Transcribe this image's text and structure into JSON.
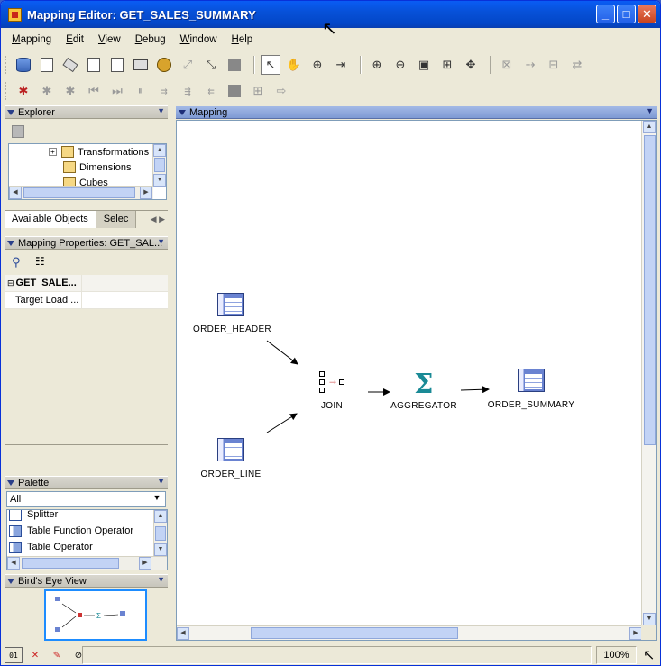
{
  "window": {
    "title": "Mapping Editor: GET_SALES_SUMMARY",
    "minimize": "_",
    "maximize": "□",
    "close": "✕"
  },
  "menu": [
    "Mapping",
    "Edit",
    "View",
    "Debug",
    "Window",
    "Help"
  ],
  "explorer": {
    "title": "Explorer",
    "tree": [
      "Transformations",
      "Dimensions",
      "Cubes"
    ],
    "tabs": [
      "Available Objects",
      "Selec"
    ]
  },
  "properties": {
    "title": "Mapping Properties: GET_SAL...",
    "rows": [
      {
        "key": "GET_SALE...",
        "value": ""
      },
      {
        "key": "Target Load ...",
        "value": ""
      }
    ]
  },
  "palette": {
    "title": "Palette",
    "filter": "All",
    "items": [
      "Splitter",
      "Table Function Operator",
      "Table Operator"
    ]
  },
  "birdseye": {
    "title": "Bird's Eye View"
  },
  "mapping": {
    "title": "Mapping",
    "nodes": {
      "order_header": "ORDER_HEADER",
      "order_line": "ORDER_LINE",
      "join": "JOIN",
      "aggregator": "AGGREGATOR",
      "order_summary": "ORDER_SUMMARY"
    }
  },
  "status": {
    "zoom": "100%"
  },
  "colors": {
    "title_bar": "#0a5cf4",
    "canvas": "#ffffff",
    "aggregator_icon": "#1a8a96"
  }
}
